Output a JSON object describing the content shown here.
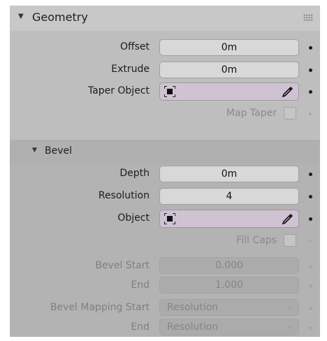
{
  "geometry": {
    "title": "Geometry",
    "offset": {
      "label": "Offset",
      "value": "0m"
    },
    "extrude": {
      "label": "Extrude",
      "value": "0m"
    },
    "taper_object": {
      "label": "Taper Object"
    },
    "map_taper": {
      "label": "Map Taper",
      "checked": false
    }
  },
  "bevel": {
    "title": "Bevel",
    "depth": {
      "label": "Depth",
      "value": "0m"
    },
    "resolution": {
      "label": "Resolution",
      "value": "4"
    },
    "object": {
      "label": "Object"
    },
    "fill_caps": {
      "label": "Fill Caps",
      "checked": false
    },
    "bevel_start": {
      "label": "Bevel Start",
      "value": "0.000"
    },
    "bevel_end": {
      "label": "End",
      "value": "1.000"
    },
    "mapping_start": {
      "label": "Bevel Mapping Start",
      "value": "Resolution"
    },
    "mapping_end": {
      "label": "End",
      "value": "Resolution"
    }
  },
  "colors": {
    "panel_bg": "#bebebe",
    "object_field": "#cfc3d3",
    "field": "#d8d8d8"
  },
  "icons": [
    "triangle-down-icon",
    "grip-icon",
    "object-icon",
    "eyedropper-icon",
    "chevron-down-icon"
  ]
}
